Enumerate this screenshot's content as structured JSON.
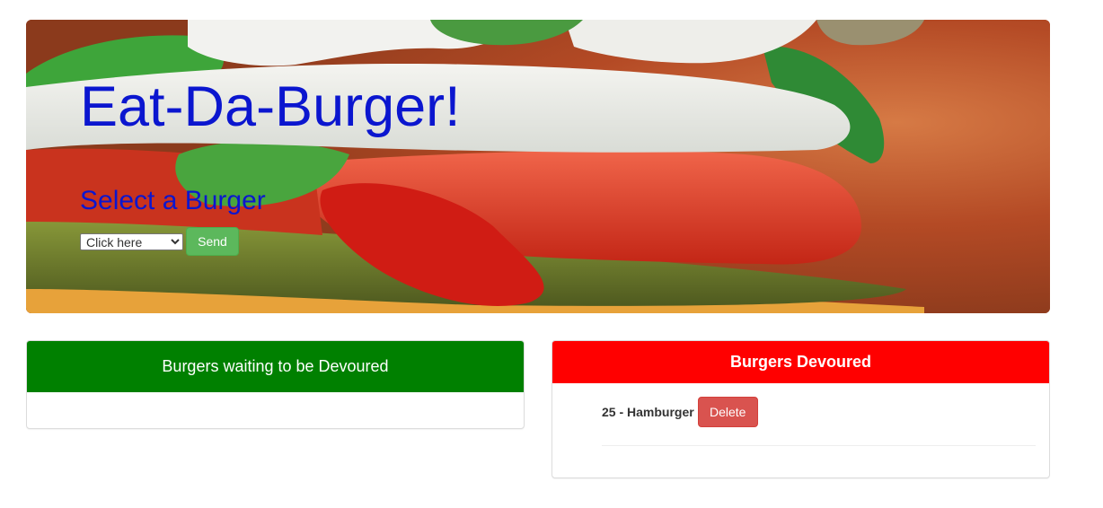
{
  "header": {
    "title": "Eat-Da-Burger!",
    "subtitle": "Select a Burger",
    "select_placeholder": "Click here",
    "send_label": "Send"
  },
  "waiting_panel": {
    "heading": "Burgers waiting to be Devoured",
    "color": "#008000",
    "items": []
  },
  "devoured_panel": {
    "heading": "Burgers Devoured",
    "color": "#ff0000",
    "items": [
      {
        "label": "25 - Hamburger",
        "delete_label": "Delete"
      }
    ]
  },
  "colors": {
    "title": "#0b16cf",
    "send_button": "#5cb85c",
    "delete_button": "#d9534f"
  }
}
